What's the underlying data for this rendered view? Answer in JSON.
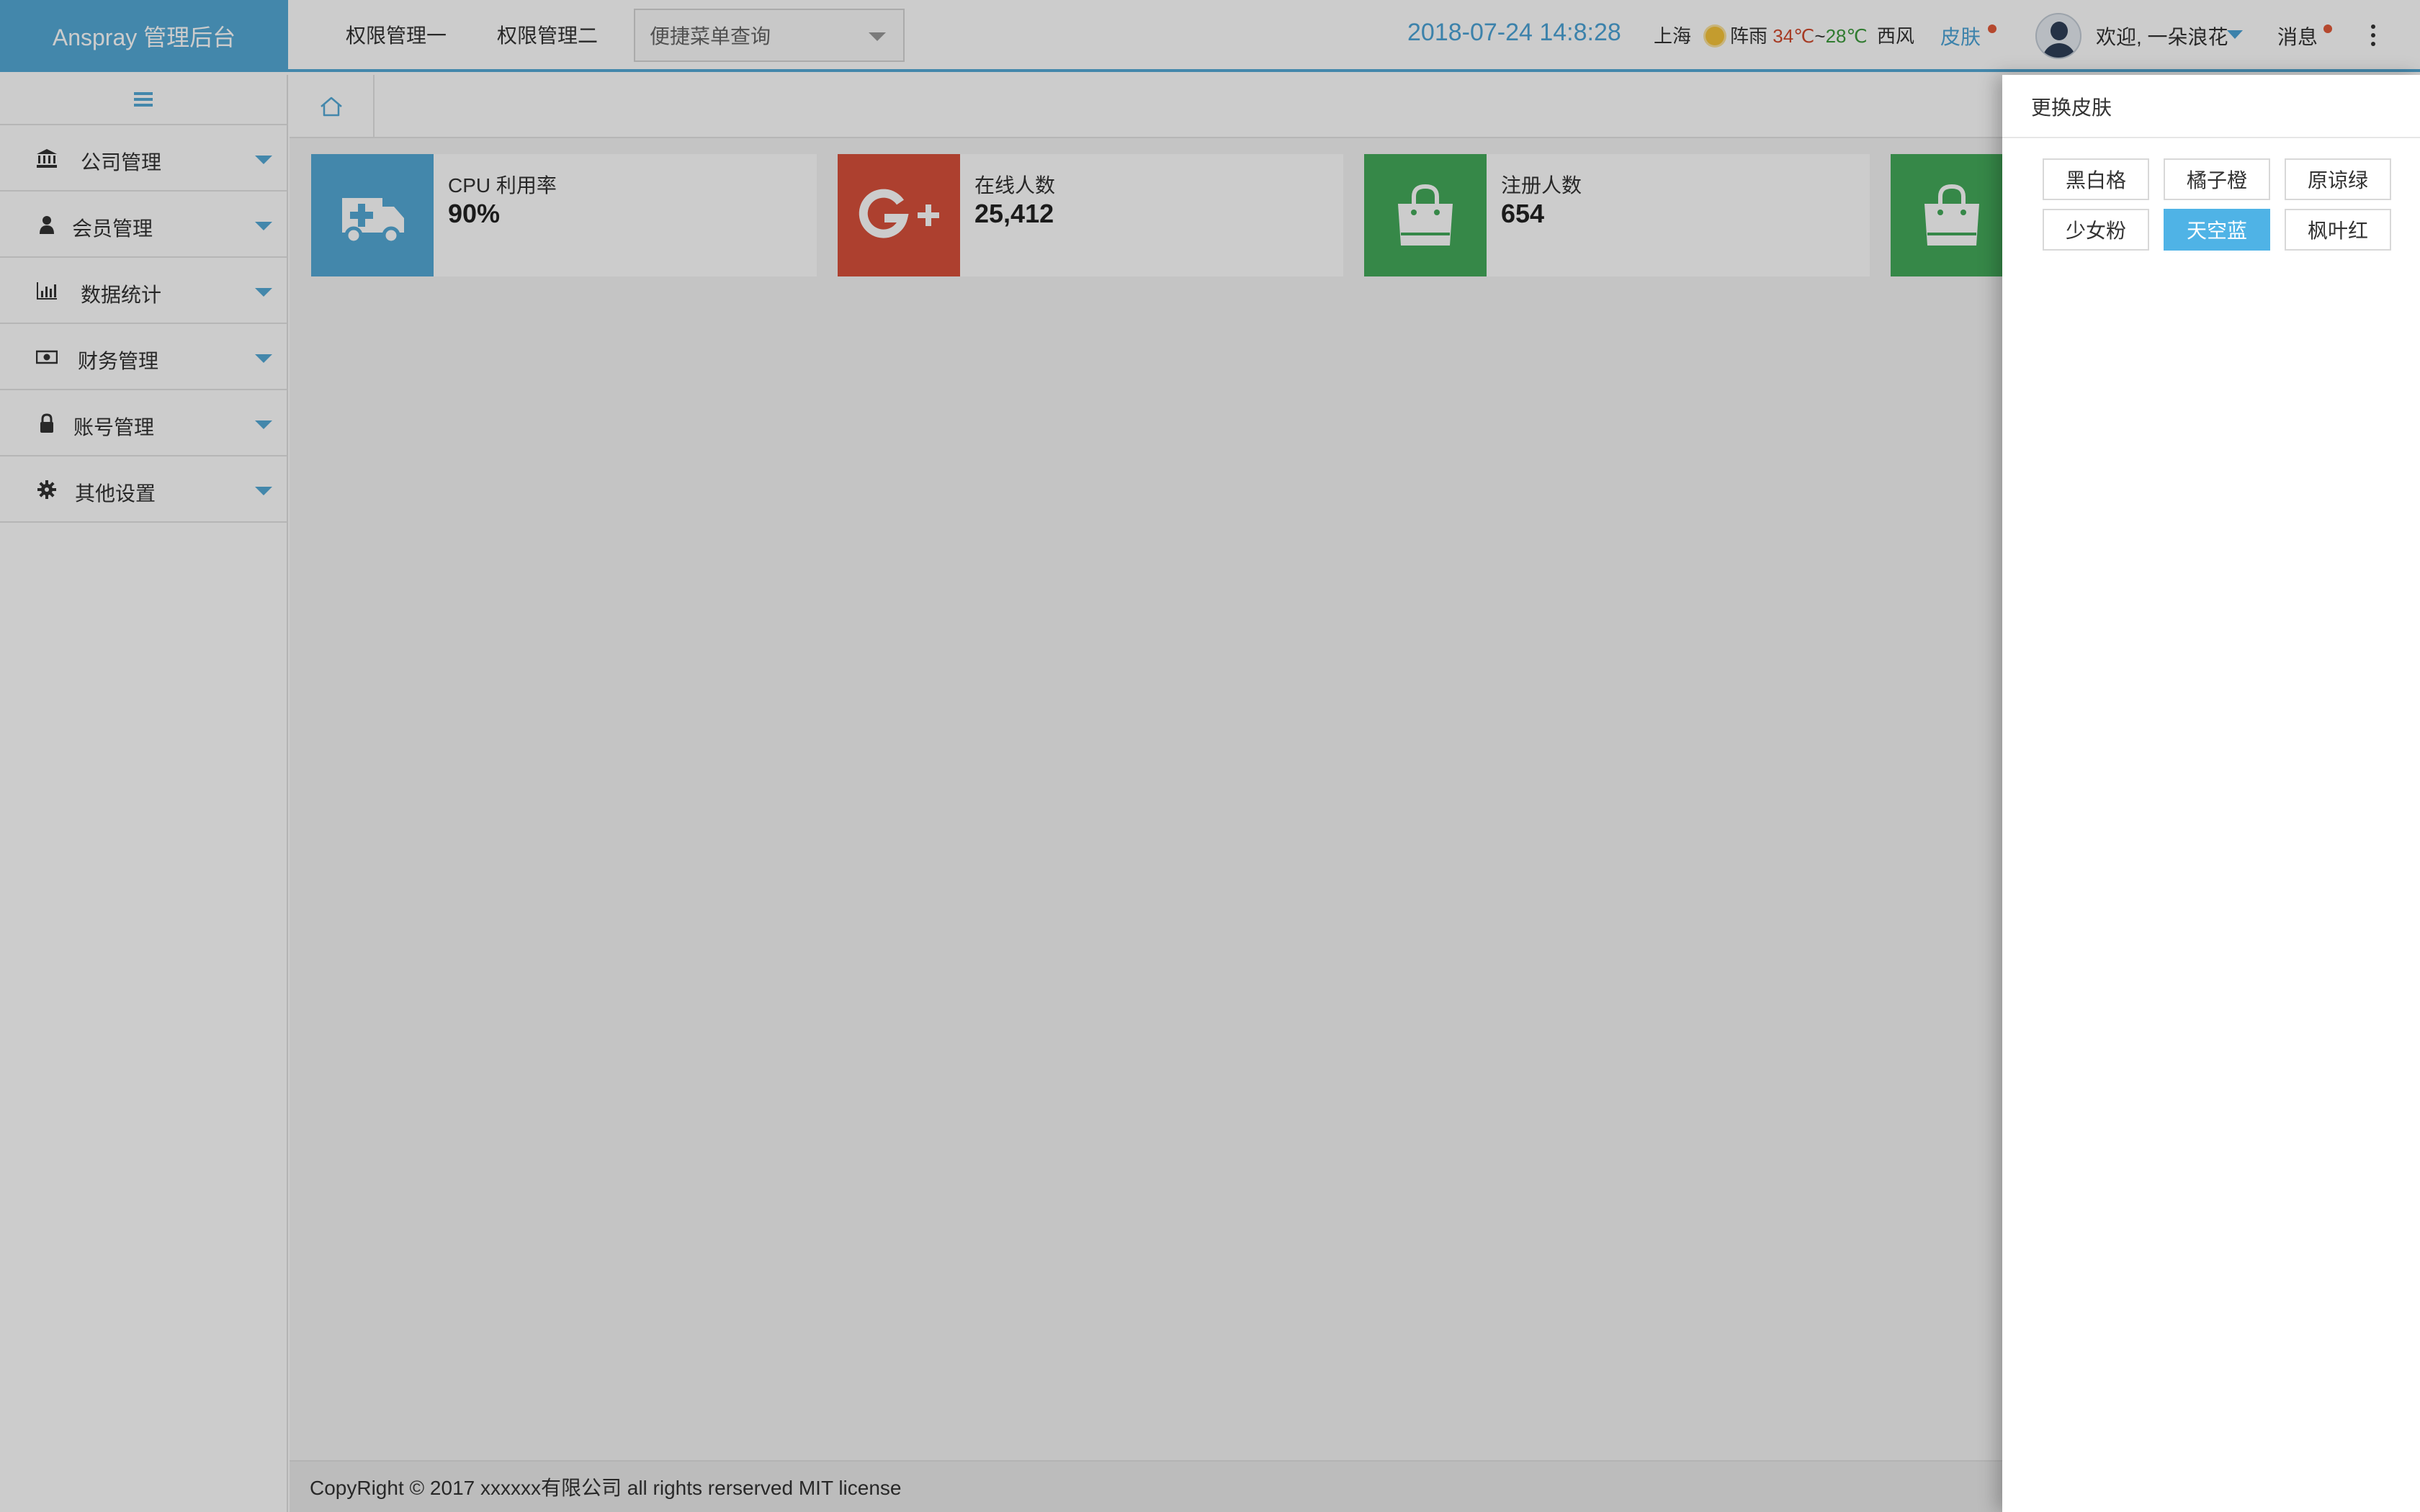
{
  "brand": {
    "title": "Anspray 管理后台"
  },
  "header": {
    "nav": [
      "权限管理一",
      "权限管理二"
    ],
    "search_placeholder": "便捷菜单查询",
    "datetime": "2018-07-24 14:8:28",
    "city": "上海",
    "weather": "阵雨",
    "temp_high": "34℃",
    "temp_sep": "~",
    "temp_low": "28℃",
    "wind": "西风",
    "skin_label": "皮肤",
    "welcome": "欢迎, 一朵浪花",
    "messages": "消息"
  },
  "sidebar": {
    "items": [
      {
        "label": "公司管理",
        "icon": "bank-icon"
      },
      {
        "label": "会员管理",
        "icon": "user-icon"
      },
      {
        "label": "数据统计",
        "icon": "bar-chart-icon"
      },
      {
        "label": "财务管理",
        "icon": "money-icon"
      },
      {
        "label": "账号管理",
        "icon": "lock-icon"
      },
      {
        "label": "其他设置",
        "icon": "gear-icon"
      }
    ]
  },
  "cards": [
    {
      "label": "CPU 利用率",
      "value": "90%",
      "color": "#54a9d6",
      "icon": "ambulance-icon"
    },
    {
      "label": "在线人数",
      "value": "25,412",
      "color": "#d9503b",
      "icon": "google-plus-icon"
    },
    {
      "label": "注册人数",
      "value": "654",
      "color": "#44ab5b",
      "icon": "shopping-bag-icon"
    },
    {
      "label": "",
      "value": "",
      "color": "#44ab5b",
      "icon": "shopping-bag-icon"
    }
  ],
  "footer": {
    "text": "CopyRight © 2017 xxxxxx有限公司 all rights rerserved MIT license"
  },
  "skin_panel": {
    "title": "更换皮肤",
    "options": [
      "黑白格",
      "橘子橙",
      "原谅绿",
      "少女粉",
      "天空蓝",
      "枫叶红"
    ],
    "selected": "天空蓝"
  },
  "colors": {
    "accent": "#54a9d6",
    "red_badge": "#e35a3a"
  }
}
